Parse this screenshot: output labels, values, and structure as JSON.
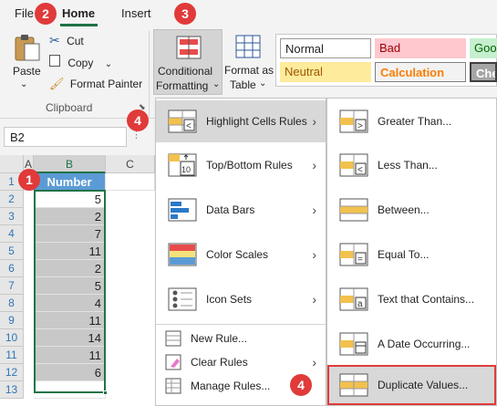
{
  "tabs": {
    "file": "File",
    "home": "Home",
    "insert": "Insert"
  },
  "clipboard": {
    "paste": "Paste",
    "cut": "Cut",
    "copy": "Copy",
    "format_painter": "Format Painter",
    "group_label": "Clipboard"
  },
  "styles_group": {
    "conditional_formatting_line1": "Conditional",
    "conditional_formatting_line2": "Formatting",
    "format_as_table_line1": "Format as",
    "format_as_table_line2": "Table",
    "cells": [
      "Normal",
      "Bad",
      "Goo",
      "Neutral",
      "Calculation",
      "Che"
    ]
  },
  "name_box": "B2",
  "sheet": {
    "columns": [
      "A",
      "B",
      "C"
    ],
    "rows": [
      "1",
      "2",
      "3",
      "4",
      "5",
      "6",
      "7",
      "8",
      "9",
      "10",
      "11",
      "12",
      "13"
    ],
    "header": "Number",
    "values": [
      "5",
      "2",
      "7",
      "11",
      "2",
      "5",
      "4",
      "11",
      "14",
      "11",
      "6"
    ]
  },
  "menu": {
    "items": [
      "Highlight Cells Rules",
      "Top/Bottom Rules",
      "Data Bars",
      "Color Scales",
      "Icon Sets"
    ],
    "small_items": [
      "New Rule...",
      "Clear Rules",
      "Manage Rules..."
    ]
  },
  "submenu": {
    "items": [
      "Greater Than...",
      "Less Than...",
      "Between...",
      "Equal To...",
      "Text that Contains...",
      "A Date Occurring...",
      "Duplicate Values..."
    ]
  },
  "badges": [
    "1",
    "2",
    "3",
    "4",
    "4"
  ],
  "colors": {
    "accent_green": "#217346",
    "badge_red": "#e03a3a",
    "header_blue": "#5b9bd5"
  }
}
